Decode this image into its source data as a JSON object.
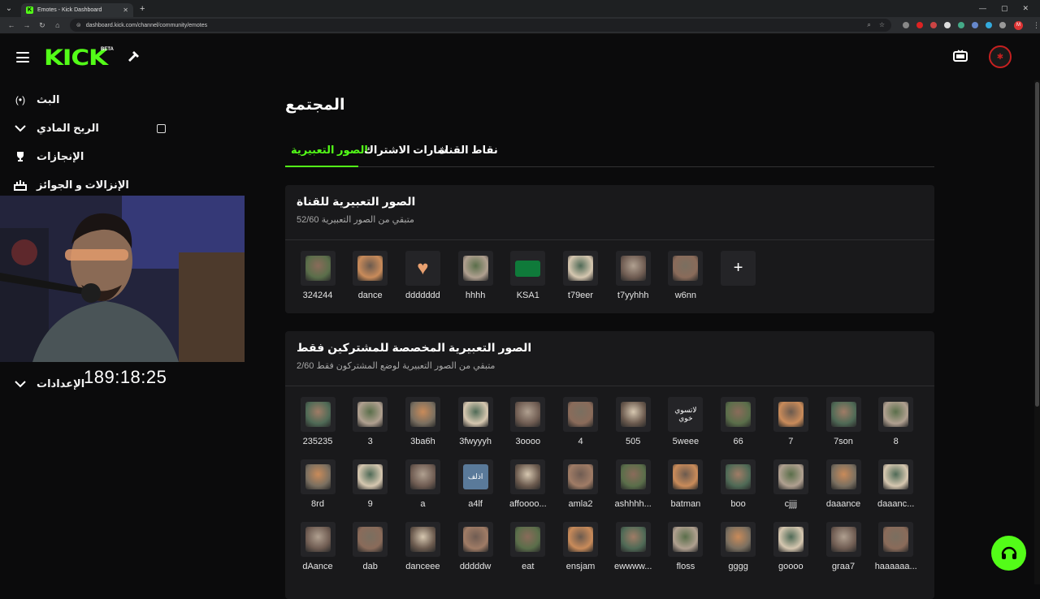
{
  "browser": {
    "tab_title": "Emotes - Kick Dashboard",
    "url": "dashboard.kick.com/channel/community/emotes",
    "profile_initial": "M"
  },
  "header": {
    "logo": "KICK",
    "beta": "BETA"
  },
  "sidebar": {
    "items": [
      {
        "label": "البث",
        "icon": "broadcast-icon"
      },
      {
        "label": "الربح المادي",
        "icon": "chevron-down-icon"
      },
      {
        "label": "الإنجازات",
        "icon": "trophy-icon"
      },
      {
        "label": "الإنزالات و الجوائز",
        "icon": "gift-icon"
      },
      {
        "label": "الإعدادات",
        "icon": "chevron-down-icon"
      }
    ],
    "timer": "189:18:25"
  },
  "main": {
    "title": "المجتمع",
    "tabs": [
      {
        "label": "الصور التعبيرية",
        "active": true
      },
      {
        "label": "شارات الاشتراك",
        "active": false
      },
      {
        "label": "نقاط القناة",
        "active": false
      }
    ],
    "channel_emotes": {
      "title": "الصور التعبيرية للقناة",
      "subtitle": "متبقي من الصور التعبيرية 52/60",
      "emotes": [
        "324244",
        "dance",
        "ddddddd",
        "hhhh",
        "KSA1",
        "t79eer",
        "t7yyhhh",
        "w6nn"
      ]
    },
    "sub_emotes": {
      "title": "الصور التعبيرية المخصصة للمشتركين فقط",
      "subtitle": "متبقي من الصور التعبيرية لوضع المشتركون فقط 2/60",
      "tile_text_5weee": "لاتسوي خوي",
      "emotes": [
        "235235",
        "3",
        "3ba6h",
        "3fwyyyh",
        "3oooo",
        "4",
        "505",
        "5weee",
        "66",
        "7",
        "7son",
        "8",
        "8rd",
        "9",
        "a",
        "a4lf",
        "affoooo...",
        "amla2",
        "ashhhh...",
        "batman",
        "boo",
        "cjjjj",
        "daaance",
        "daaanc...",
        "dAance",
        "dab",
        "danceee",
        "dddddw",
        "eat",
        "ensjam",
        "ewwww...",
        "floss",
        "gggg",
        "goooo",
        "graa7",
        "haaaaaa..."
      ],
      "tile_text_a4lf": "اذلف"
    }
  },
  "colors": {
    "accent": "#53fc18",
    "card": "#19191b",
    "background": "#0b0b0c",
    "avatar_ring": "#c62020"
  }
}
